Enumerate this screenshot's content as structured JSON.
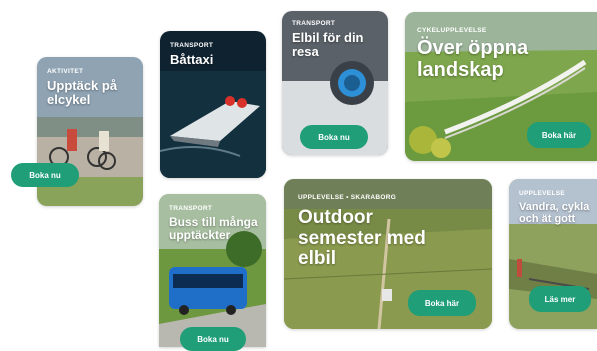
{
  "cards": [
    {
      "category": "Aktivitet",
      "title": "Upptäck på elcykel",
      "button": "Boka nu"
    },
    {
      "category": "Transport",
      "title": "Båttaxi"
    },
    {
      "category": "Transport",
      "title": "Elbil för din resa",
      "button": "Boka nu"
    },
    {
      "category": "Cykelupplevelse",
      "title": "Över öppna landskap",
      "button": "Boka här"
    },
    {
      "category": "Transport",
      "title": "Buss till många upptäckter",
      "button": "Boka nu"
    },
    {
      "category": "Upplevelse • Skaraborg",
      "title": "Outdoor semester med elbil",
      "button": "Boka här"
    },
    {
      "category": "Upplevelse",
      "title": "Vandra, cykla och ät gott",
      "button": "Läs mer"
    }
  ],
  "colors": {
    "accent": "#1f9e78"
  }
}
